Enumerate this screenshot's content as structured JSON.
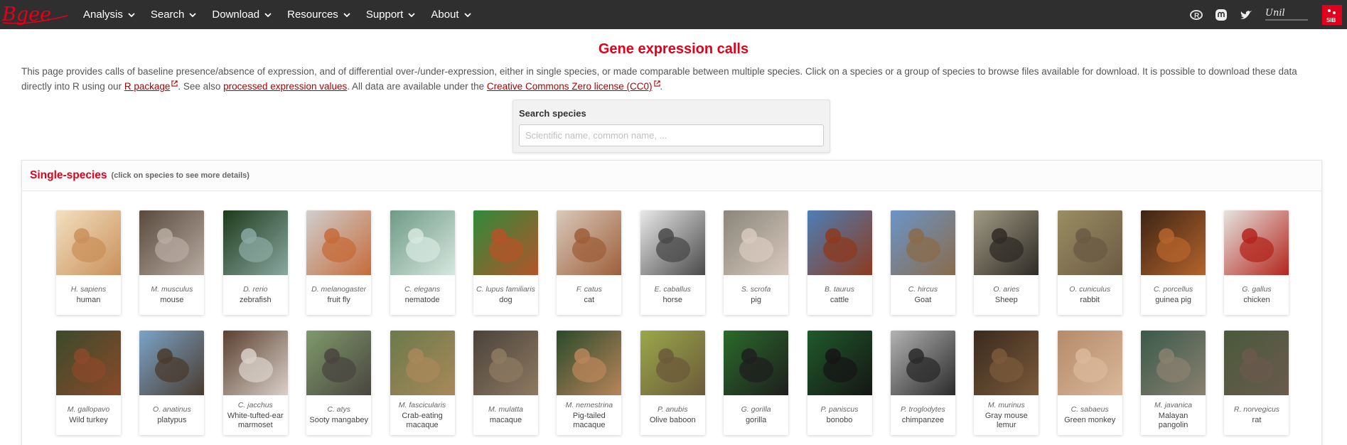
{
  "nav": {
    "logo_text": "Bgee",
    "menu": [
      "Analysis",
      "Search",
      "Download",
      "Resources",
      "Support",
      "About"
    ],
    "right_icons": [
      "r-package-icon",
      "mastodon-icon",
      "twitter-icon",
      "unil-logo",
      "sib-logo"
    ],
    "unil_text": "Unil",
    "sib_text": "SIB"
  },
  "page": {
    "title": "Gene expression calls",
    "intro_part1": "This page provides calls of baseline presence/absence of expression, and of differential over-/under-expression, either in single species, or made comparable between multiple species. Click on a species or a group of species to browse files available for download. It is possible to download these data directly into R using our ",
    "link_r_package": "R package",
    "intro_part2": ". See also ",
    "link_processed": "processed expression values",
    "intro_part3": ". All data are available under the ",
    "link_license": "Creative Commons Zero license (CC0)",
    "intro_part4": "."
  },
  "search": {
    "label": "Search species",
    "placeholder": "Scientific name, common name, ..."
  },
  "single_species": {
    "title": "Single-species",
    "hint": "(click on species to see more details)"
  },
  "species": [
    {
      "sci": "H. sapiens",
      "common": "human",
      "colors": [
        "#f3e0c0",
        "#c9905a"
      ]
    },
    {
      "sci": "M. musculus",
      "common": "mouse",
      "colors": [
        "#5a4a3e",
        "#b7aaa0"
      ]
    },
    {
      "sci": "D. rerio",
      "common": "zebrafish",
      "colors": [
        "#1e3a1c",
        "#8aa8a0"
      ]
    },
    {
      "sci": "D. melanogaster",
      "common": "fruit fly",
      "colors": [
        "#d0cfcf",
        "#c56b3a"
      ]
    },
    {
      "sci": "C. elegans",
      "common": "nematode",
      "colors": [
        "#6f9a86",
        "#d6e7df"
      ]
    },
    {
      "sci": "C. lupus familiaris",
      "common": "dog",
      "colors": [
        "#2f8a3a",
        "#b4542a"
      ]
    },
    {
      "sci": "F. catus",
      "common": "cat",
      "colors": [
        "#d9c9bb",
        "#9e5f3a"
      ]
    },
    {
      "sci": "E. caballus",
      "common": "horse",
      "colors": [
        "#e9e9e9",
        "#4a4a4a"
      ]
    },
    {
      "sci": "S. scrofa",
      "common": "pig",
      "colors": [
        "#8a857a",
        "#d8c9bd"
      ]
    },
    {
      "sci": "B. taurus",
      "common": "cattle",
      "colors": [
        "#4d7fb7",
        "#8c3a1e"
      ]
    },
    {
      "sci": "C. hircus",
      "common": "Goat",
      "colors": [
        "#6b95c9",
        "#8a6b4a"
      ]
    },
    {
      "sci": "O. aries",
      "common": "Sheep",
      "colors": [
        "#a09a84",
        "#2f2b26"
      ]
    },
    {
      "sci": "O. cuniculus",
      "common": "rabbit",
      "colors": [
        "#9a8e62",
        "#6b5a44"
      ]
    },
    {
      "sci": "C. porcellus",
      "common": "guinea pig",
      "colors": [
        "#3d2416",
        "#b5642b"
      ]
    },
    {
      "sci": "G. gallus",
      "common": "chicken",
      "colors": [
        "#e6e3df",
        "#b3251c"
      ]
    },
    {
      "sci": "M. gallopavo",
      "common": "Wild turkey",
      "colors": [
        "#3b4a2a",
        "#8a4a2a"
      ]
    },
    {
      "sci": "O. anatinus",
      "common": "platypus",
      "colors": [
        "#7ba3c8",
        "#4a3b2e"
      ]
    },
    {
      "sci": "C. jacchus",
      "common": "White-tufted-ear marmoset",
      "colors": [
        "#5a4030",
        "#d9d0c8"
      ]
    },
    {
      "sci": "C. atys",
      "common": "Sooty mangabey",
      "colors": [
        "#7f9a6a",
        "#4a4540"
      ]
    },
    {
      "sci": "M. fascicularis",
      "common": "Crab-eating macaque",
      "colors": [
        "#6b7a4a",
        "#a9885a"
      ]
    },
    {
      "sci": "M. mulatta",
      "common": "macaque",
      "colors": [
        "#4a423a",
        "#8e7a62"
      ]
    },
    {
      "sci": "M. nemestrina",
      "common": "Pig-tailed macaque",
      "colors": [
        "#2a4a2a",
        "#b9855a"
      ]
    },
    {
      "sci": "P. anubis",
      "common": "Olive baboon",
      "colors": [
        "#9aa84a",
        "#6b5a3a"
      ]
    },
    {
      "sci": "G. gorilla",
      "common": "gorilla",
      "colors": [
        "#2a6a2a",
        "#1e1e1e"
      ]
    },
    {
      "sci": "P. paniscus",
      "common": "bonobo",
      "colors": [
        "#1f5a2a",
        "#151515"
      ]
    },
    {
      "sci": "P. troglodytes",
      "common": "chimpanzee",
      "colors": [
        "#b3b3b3",
        "#2a2a2a"
      ]
    },
    {
      "sci": "M. murinus",
      "common": "Gray mouse lemur",
      "colors": [
        "#3a2a1e",
        "#7a5a3a"
      ]
    },
    {
      "sci": "C. sabaeus",
      "common": "Green monkey",
      "colors": [
        "#b58a6a",
        "#d9b89a"
      ]
    },
    {
      "sci": "M. javanica",
      "common": "Malayan pangolin",
      "colors": [
        "#3a5a4a",
        "#8a8070"
      ]
    },
    {
      "sci": "R. norvegicus",
      "common": "rat",
      "colors": [
        "#4a5a3a",
        "#6a5a4e"
      ]
    }
  ]
}
